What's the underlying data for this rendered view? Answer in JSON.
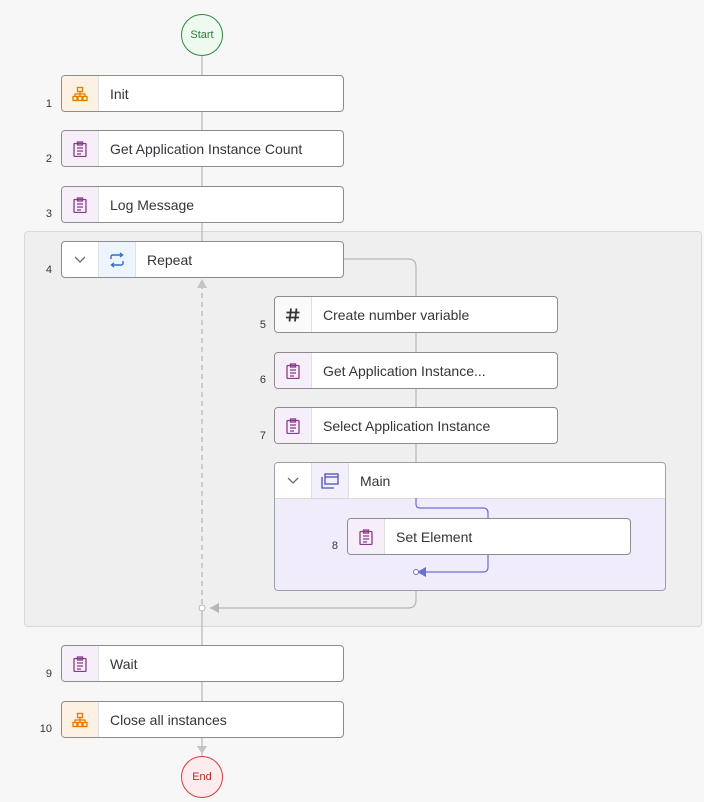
{
  "flow": {
    "start_label": "Start",
    "end_label": "End",
    "steps": [
      {
        "num": "1",
        "label": "Init",
        "icon": "sitemap-icon"
      },
      {
        "num": "2",
        "label": "Get Application Instance Count",
        "icon": "clipboard-icon"
      },
      {
        "num": "3",
        "label": "Log Message",
        "icon": "clipboard-icon"
      },
      {
        "num": "4",
        "label": "Repeat",
        "icon": "loop-icon"
      },
      {
        "num": "5",
        "label": "Create number variable",
        "icon": "hash-icon"
      },
      {
        "num": "6",
        "label": "Get Application Instance...",
        "icon": "clipboard-icon"
      },
      {
        "num": "7",
        "label": "Select Application Instance",
        "icon": "clipboard-icon"
      },
      {
        "num": "",
        "label": "Main",
        "icon": "window-icon"
      },
      {
        "num": "8",
        "label": "Set Element",
        "icon": "clipboard-icon"
      },
      {
        "num": "9",
        "label": "Wait",
        "icon": "clipboard-icon"
      },
      {
        "num": "10",
        "label": "Close all instances",
        "icon": "sitemap-icon"
      }
    ]
  },
  "colors": {
    "orange_icon": "#e07b00",
    "purple_icon": "#8a3a8a",
    "blue_icon": "#2f6fc9",
    "start": "#2b8a3e",
    "end": "#d43c3c",
    "main_region": "#f1ecfc",
    "inner_flow": "#6a6fd0"
  }
}
